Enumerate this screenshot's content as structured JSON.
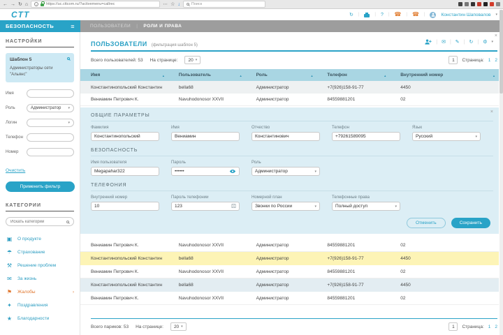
{
  "browser": {
    "url": "https://uc.cttcom.ru/?activemenu=callrec",
    "search_placeholder": "Поиск"
  },
  "header": {
    "logo": "CTT",
    "help": "?",
    "user": "Константин Шаповалов"
  },
  "nav": {
    "module": "БЕЗОПАСНОСТЬ",
    "crumb1": "ПОЛЬЗОВАТЕЛИ",
    "crumb2": "РОЛИ И ПРАВА"
  },
  "sidebar": {
    "settings_title": "НАСТРОЙКИ",
    "template": {
      "name": "Шаблон 5",
      "desc": "Администраторы сети \"Альянс\""
    },
    "filter": {
      "name_label": "Имя",
      "name_value": "",
      "role_label": "Роль",
      "role_value": "Администратор",
      "login_label": "Логин",
      "login_value": "",
      "phone_label": "Телефон",
      "phone_value": "",
      "number_label": "Номер",
      "number_value": "",
      "clear": "Очистить",
      "apply": "Применить фильтр"
    },
    "categories": {
      "title": "КАТЕГОРИИ",
      "search_placeholder": "Искать категории",
      "items": [
        {
          "label": "О продукте",
          "icon": "▣"
        },
        {
          "label": "Страхование",
          "icon": "☂"
        },
        {
          "label": "Решение проблем",
          "icon": "⚒"
        },
        {
          "label": "За жизнь",
          "icon": "✉"
        },
        {
          "label": "Жалобы",
          "icon": "⚑",
          "more": "›"
        },
        {
          "label": "Поздравления",
          "icon": "✦"
        },
        {
          "label": "Благодарности",
          "icon": "★"
        }
      ]
    }
  },
  "main": {
    "title": "ПОЛЬЗОВАТЕЛИ",
    "subtitle": "(фильтрация шаблон 5)",
    "count_top": "Всего пользователей: 53",
    "per_page_label": "На странице:",
    "per_page": "20",
    "page_box": "1",
    "page_label": "Страница:",
    "page1": "1",
    "page2": "2",
    "table": {
      "headers": [
        "Имя",
        "Пользователь",
        "Роль",
        "Телефон",
        "Внутренний номер"
      ],
      "rows": [
        [
          "Константинопольский Константин",
          "bella68",
          "Администратор",
          "+7(926)158-91-77",
          "4450"
        ],
        [
          "Вениамин Петрович К.",
          "Navuhodonosor XXVII",
          "Администратор",
          "84559881201",
          "02"
        ],
        [
          "Вениамин Петрович К.",
          "Navuhodonosor XXVII",
          "Администратор",
          "84559881201",
          "02"
        ],
        [
          "Константинопольский Константин",
          "bella68",
          "Администратор",
          "+7(926)158-91-77",
          "4450"
        ],
        [
          "Вениамин Петрович К.",
          "Navuhodonosor XXVII",
          "Администратор",
          "84559881201",
          "02"
        ],
        [
          "Константинопольский Константин",
          "bella68",
          "Администратор",
          "+7(926)158-91-77",
          "4450"
        ],
        [
          "Вениамин Петрович К.",
          "Navuhodonosor XXVII",
          "Администратор",
          "84559881201",
          "02"
        ]
      ]
    },
    "form": {
      "general_title": "ОБЩИЕ ПАРАМЕТРЫ",
      "lastname_label": "Фамилия",
      "lastname": "Константинопольский",
      "firstname_label": "Имя",
      "firstname": "Вениамин",
      "middlename_label": "Отчество",
      "middlename": "Константинович",
      "phone_label": "Телефон",
      "phone": "+79261589095",
      "lang_label": "Язык",
      "lang": "Русский",
      "security_title": "БЕЗОПАСНОСТЬ",
      "username_label": "Имя пользователя",
      "username": "Megapahar322",
      "password_label": "Пароль",
      "password": "••••••",
      "role_label": "Роль",
      "role": "Администратор",
      "telephony_title": "ТЕЛЕФОНИЯ",
      "ext_label": "Внутренний номер",
      "ext": "10",
      "telpass_label": "Пароль телефонии",
      "telpass": "123",
      "plan_label": "Номерной план",
      "plan": "Звонки по России",
      "rights_label": "Телефонные права",
      "rights": "Полный доступ",
      "cancel": "Отменить",
      "save": "Сохранить"
    },
    "footer": {
      "count": "Всего париков: 53",
      "per_page_label": "На странице:",
      "per_page": "20",
      "page_box": "1",
      "page_label": "Страница:",
      "page1": "1",
      "page2": "2"
    }
  },
  "icons": {
    "back": "←",
    "forward": "→",
    "reload": "↻",
    "home": "⌂",
    "dots": "⋯",
    "star": "☆",
    "download": "↓",
    "menu": "≡",
    "crumb_sep": "|",
    "refresh": "↻",
    "phone": "☎",
    "caret": "▾",
    "mail": "✉",
    "edit": "✎",
    "gear": "⚙",
    "close": "×",
    "sort_up": "▲",
    "sort_down": "▼",
    "die": "⚄",
    "sep": "|",
    "person": "i"
  }
}
